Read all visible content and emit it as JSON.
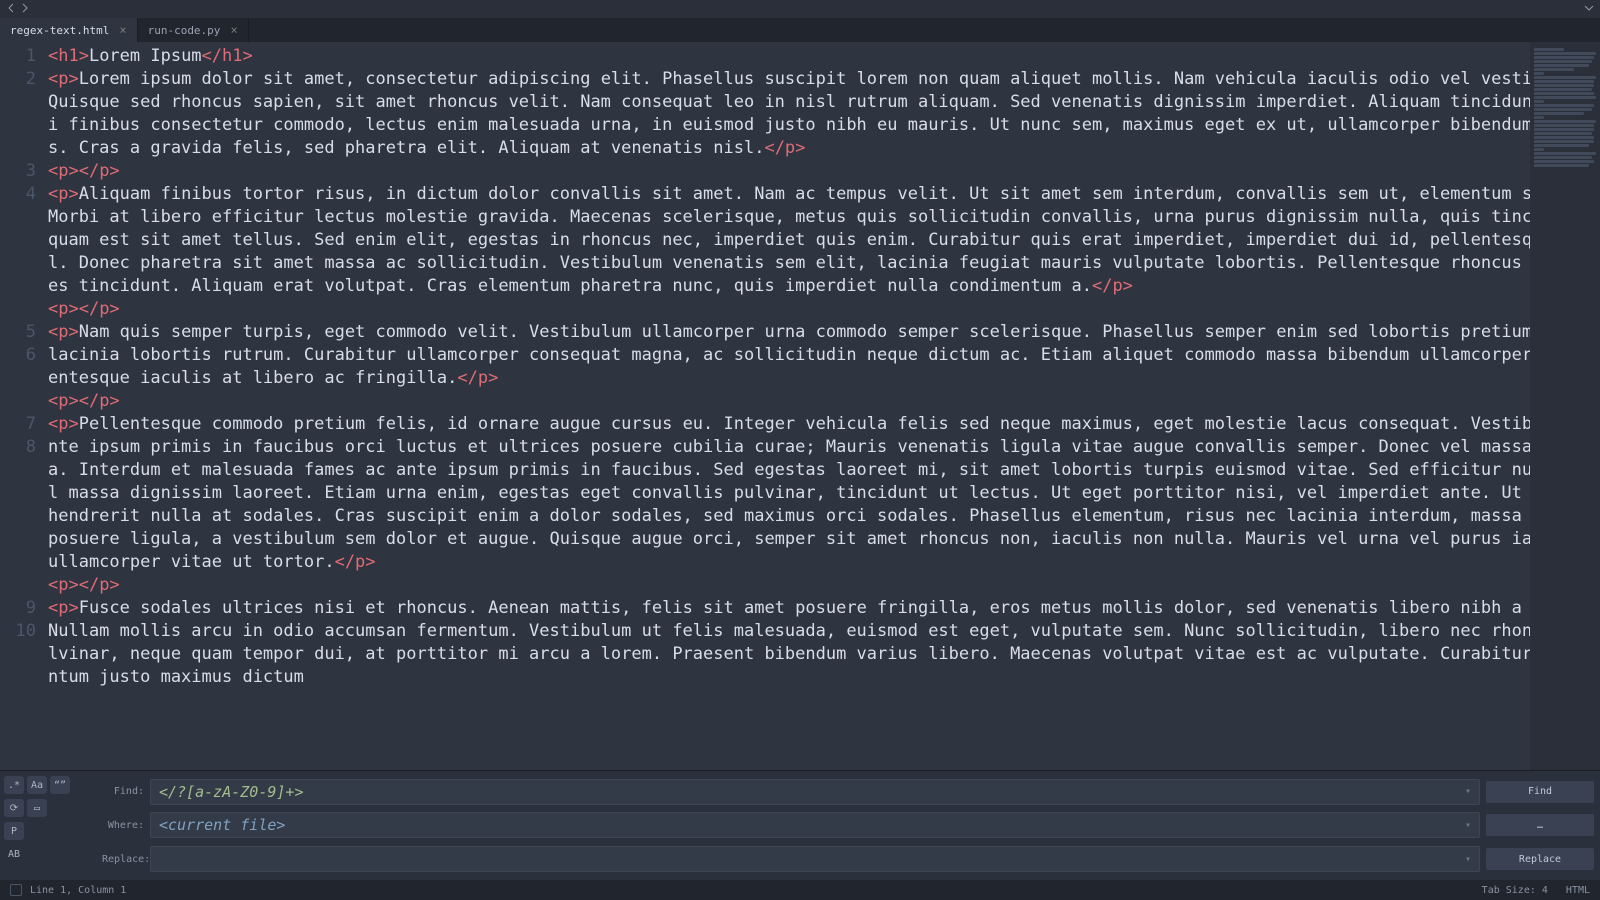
{
  "tabs": [
    {
      "label": "regex-text.html",
      "active": true
    },
    {
      "label": "run-code.py",
      "active": false
    }
  ],
  "lines": [
    {
      "n": "1",
      "segments": [
        {
          "t": "tag",
          "v": "<h1>"
        },
        {
          "t": "txt",
          "v": "Lorem Ipsum"
        },
        {
          "t": "tag",
          "v": "</h1>"
        }
      ]
    },
    {
      "n": "2",
      "segments": [
        {
          "t": "tag",
          "v": "<p>"
        },
        {
          "t": "txt",
          "v": "Lorem ipsum dolor sit amet, consectetur adipiscing elit. Phasellus suscipit lorem non quam aliquet mollis. Nam vehicula iaculis odio vel vestibulum. Quisque sed rhoncus sapien, sit amet rhoncus velit. Nam consequat leo in nisl rutrum aliquam. Sed venenatis dignissim imperdiet. Aliquam tincidunt, orci finibus consectetur commodo, lectus enim malesuada urna, in euismod justo nibh eu mauris. Ut nunc sem, maximus eget ex ut, ullamcorper bibendum tellus. Cras a gravida felis, sed pharetra elit. Aliquam at venenatis nisl."
        },
        {
          "t": "tag",
          "v": "</p>"
        }
      ]
    },
    {
      "n": "3",
      "segments": [
        {
          "t": "tag",
          "v": "<p>"
        },
        {
          "t": "tag",
          "v": "</p>"
        }
      ]
    },
    {
      "n": "4",
      "segments": [
        {
          "t": "tag",
          "v": "<p>"
        },
        {
          "t": "txt",
          "v": "Aliquam finibus tortor risus, in dictum dolor convallis sit amet. Nam ac tempus velit. Ut sit amet sem interdum, convallis sem ut, elementum sapien. Morbi at libero efficitur lectus molestie gravida. Maecenas scelerisque, metus quis sollicitudin convallis, urna purus dignissim nulla, quis tincidunt quam est sit amet tellus. Sed enim elit, egestas in rhoncus nec, imperdiet quis enim. Curabitur quis erat imperdiet, imperdiet dui id, pellentesque nisl. Donec pharetra sit amet massa ac sollicitudin. Vestibulum venenatis sem elit, lacinia feugiat mauris vulputate lobortis. Pellentesque rhoncus ultrices tincidunt. Aliquam erat volutpat. Cras elementum pharetra nunc, quis imperdiet nulla condimentum a."
        },
        {
          "t": "tag",
          "v": "</p>"
        }
      ]
    },
    {
      "n": "5",
      "segments": [
        {
          "t": "tag",
          "v": "<p>"
        },
        {
          "t": "tag",
          "v": "</p>"
        }
      ]
    },
    {
      "n": "6",
      "segments": [
        {
          "t": "tag",
          "v": "<p>"
        },
        {
          "t": "txt",
          "v": "Nam quis semper turpis, eget commodo velit. Vestibulum ullamcorper urna commodo semper scelerisque. Phasellus semper enim sed lobortis pretium. Nam lacinia lobortis rutrum. Curabitur ullamcorper consequat magna, ac sollicitudin neque dictum ac. Etiam aliquet commodo massa bibendum ullamcorper. Pellentesque iaculis at libero ac fringilla."
        },
        {
          "t": "tag",
          "v": "</p>"
        }
      ]
    },
    {
      "n": "7",
      "segments": [
        {
          "t": "tag",
          "v": "<p>"
        },
        {
          "t": "tag",
          "v": "</p>"
        }
      ]
    },
    {
      "n": "8",
      "segments": [
        {
          "t": "tag",
          "v": "<p>"
        },
        {
          "t": "txt",
          "v": "Pellentesque commodo pretium felis, id ornare augue cursus eu. Integer vehicula felis sed neque maximus, eget molestie lacus consequat. Vestibulum ante ipsum primis in faucibus orci luctus et ultrices posuere cubilia curae; Mauris venenatis ligula vitae augue convallis semper. Donec vel massa nulla. Interdum et malesuada fames ac ante ipsum primis in faucibus. Sed egestas laoreet mi, sit amet lobortis turpis euismod vitae. Sed efficitur nulla vel massa dignissim laoreet. Etiam urna enim, egestas eget convallis pulvinar, tincidunt ut lectus. Ut eget porttitor nisi, vel imperdiet ante. Ut congue hendrerit nulla at sodales. Cras suscipit enim a dolor sodales, sed maximus orci sodales. Phasellus elementum, risus nec lacinia interdum, massa metus posuere ligula, a vestibulum sem dolor et augue. Quisque augue orci, semper sit amet rhoncus non, iaculis non nulla. Mauris vel urna vel purus iaculis ullamcorper vitae ut tortor."
        },
        {
          "t": "tag",
          "v": "</p>"
        }
      ]
    },
    {
      "n": "9",
      "segments": [
        {
          "t": "tag",
          "v": "<p>"
        },
        {
          "t": "tag",
          "v": "</p>"
        }
      ]
    },
    {
      "n": "10",
      "segments": [
        {
          "t": "tag",
          "v": "<p>"
        },
        {
          "t": "txt",
          "v": "Fusce sodales ultrices nisi et rhoncus. Aenean mattis, felis sit amet posuere fringilla, eros metus mollis dolor, sed venenatis libero nibh a urna. Nullam mollis arcu in odio accumsan fermentum. Vestibulum ut felis malesuada, euismod est eget, vulputate sem. Nunc sollicitudin, libero nec rhoncus pulvinar, neque quam tempor dui, at porttitor mi arcu a lorem. Praesent bibendum varius libero. Maecenas volutpat vitae est ac vulputate. Curabitur fermentum justo maximus dictum"
        }
      ]
    }
  ],
  "search": {
    "find_label": "Find:",
    "where_label": "Where:",
    "replace_label": "Replace:",
    "find_value": "</?[a-zA-Z0-9]+>",
    "where_value": "<current file>",
    "replace_value": "",
    "btn_find": "Find",
    "btn_more": "…",
    "btn_replace": "Replace",
    "opt_regex": ".*",
    "opt_case": "Aa",
    "opt_word": "“”",
    "opt_wrap": "⟳",
    "opt_sel": "▭",
    "opt_preserve": "P",
    "opt_context": "AB"
  },
  "status": {
    "position": "Line 1, Column 1",
    "tabsize": "Tab Size: 4",
    "syntax": "HTML"
  }
}
